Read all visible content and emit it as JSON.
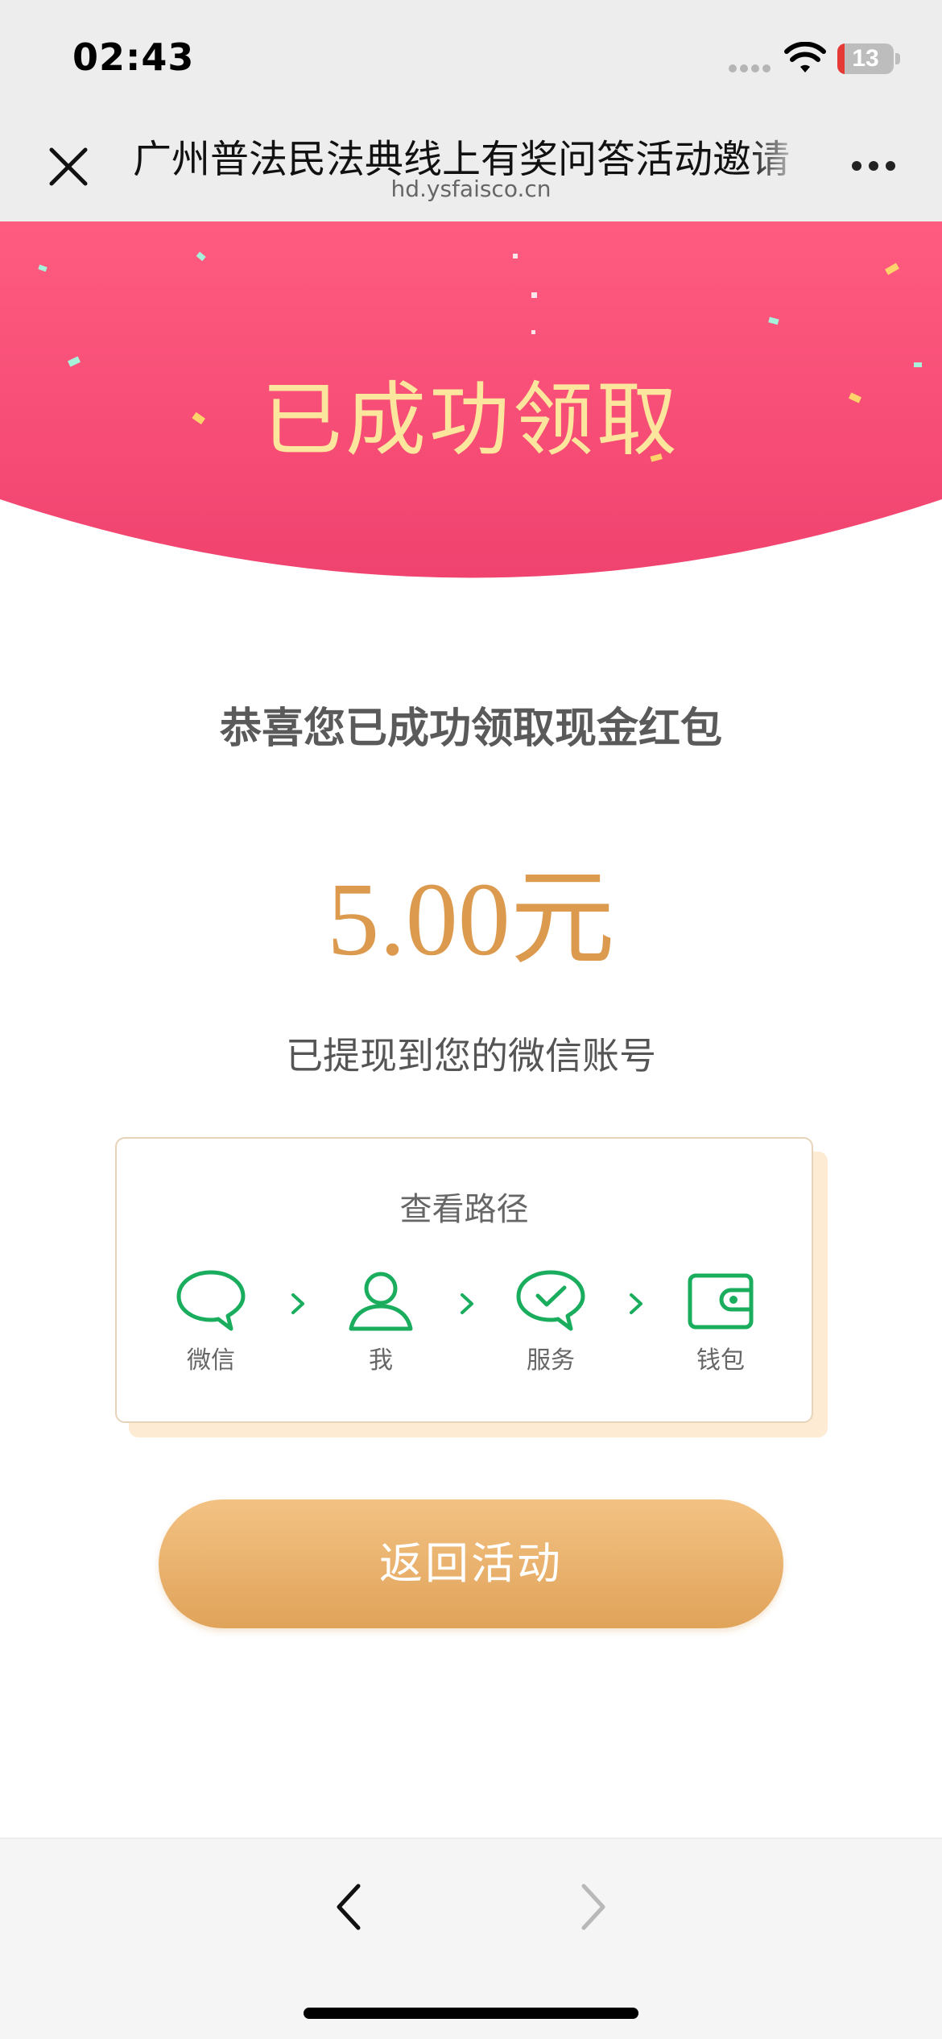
{
  "status_bar": {
    "time": "02:43",
    "battery_level": "13",
    "icons": [
      "cellular-signal-icon",
      "wifi-icon",
      "battery-icon"
    ]
  },
  "nav": {
    "title": "广州普法民法典线上有奖问答活动邀请",
    "url": "hd.ysfaisco.cn",
    "icons": [
      "close-icon",
      "more-icon"
    ]
  },
  "banner": {
    "text": "已成功领取",
    "colors": {
      "top": "#ff5b80",
      "bottom": "#f0436f",
      "text": "#fce59c"
    }
  },
  "main": {
    "congrats": "恭喜您已成功领取现金红包",
    "amount": "5.00元",
    "withdrawn": "已提现到您的微信账号"
  },
  "path": {
    "title": "查看路径",
    "steps": [
      {
        "label": "微信",
        "icon": "wechat-chat-icon"
      },
      {
        "label": "我",
        "icon": "user-icon"
      },
      {
        "label": "服务",
        "icon": "service-check-icon"
      },
      {
        "label": "钱包",
        "icon": "wallet-icon"
      }
    ],
    "accent_color": "#1aad5e"
  },
  "actions": {
    "return_label": "返回活动",
    "button_color": "#e8ad69"
  },
  "toolbar": {
    "icons": [
      "back-arrow-icon",
      "forward-arrow-icon"
    ]
  }
}
